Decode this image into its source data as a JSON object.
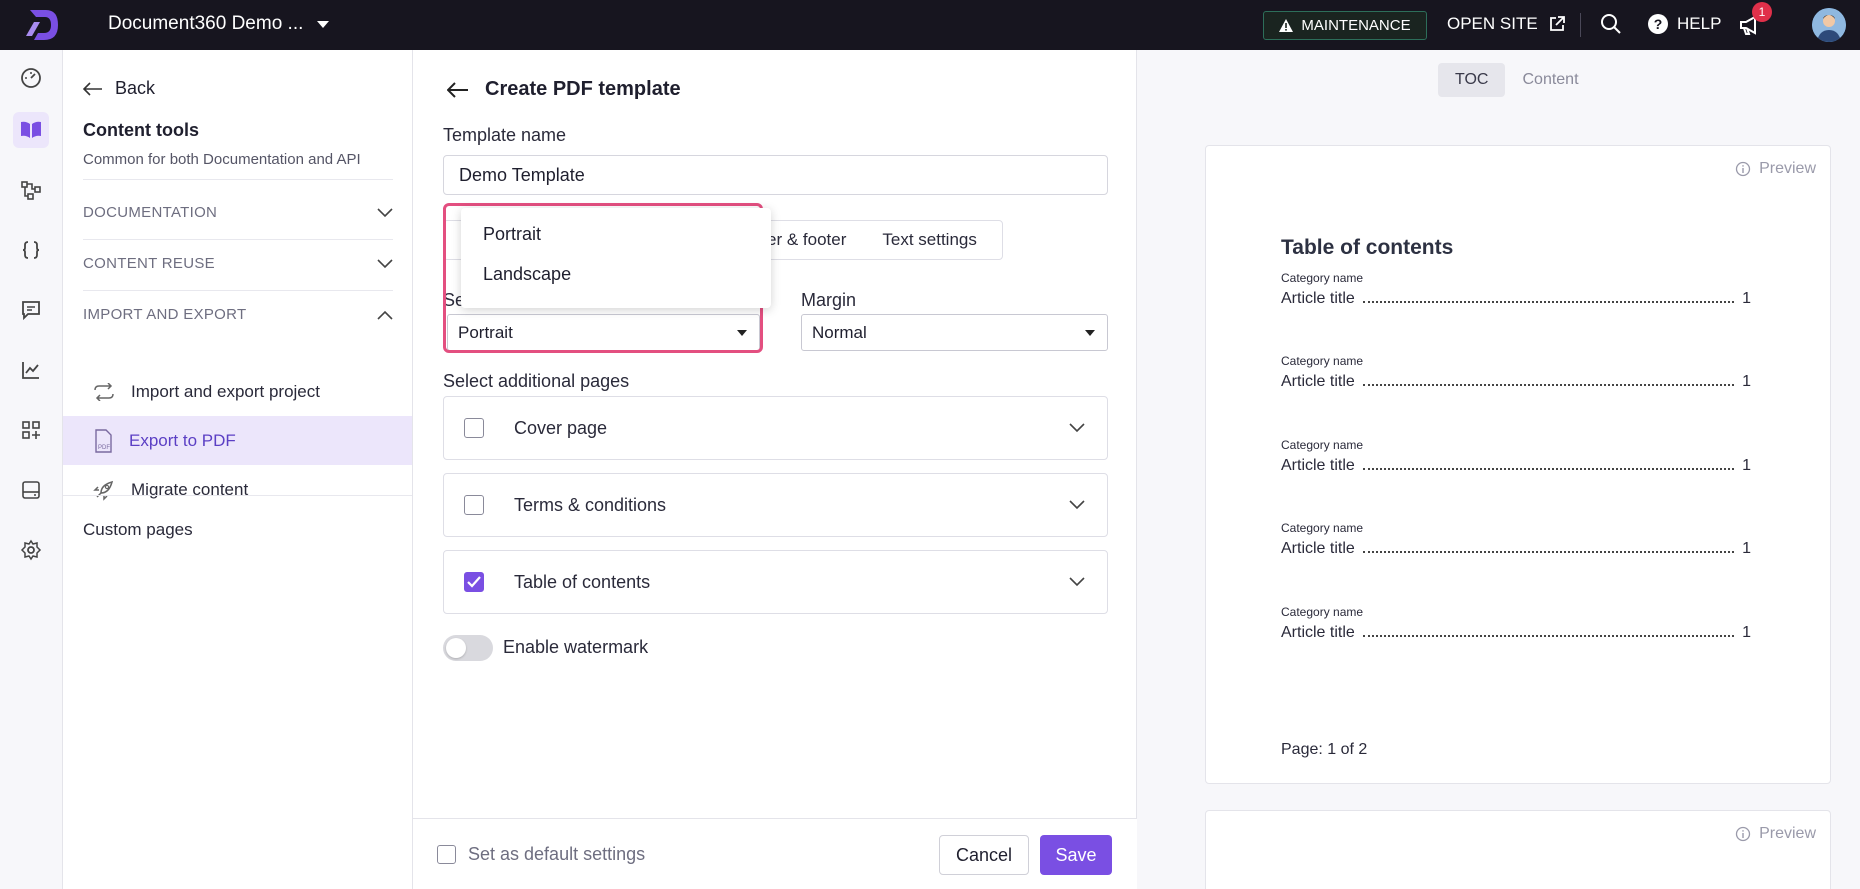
{
  "topbar": {
    "project_title": "Document360 Demo ...",
    "maintenance_label": "MAINTENANCE",
    "open_site_label": "OPEN SITE",
    "help_label": "HELP",
    "notification_count": "1"
  },
  "leftnav": {
    "back_label": "Back",
    "title": "Content tools",
    "subtitle": "Common for both Documentation and API",
    "sections": [
      {
        "label": "DOCUMENTATION",
        "expanded": false
      },
      {
        "label": "CONTENT REUSE",
        "expanded": false
      },
      {
        "label": "IMPORT AND EXPORT",
        "expanded": true
      }
    ],
    "items": [
      {
        "label": "Import and export project",
        "icon": "import-export-icon",
        "active": false
      },
      {
        "label": "Export to PDF",
        "icon": "pdf-file-icon",
        "active": true
      },
      {
        "label": "Migrate content",
        "icon": "rocket-icon",
        "active": false
      }
    ],
    "custom_pages_label": "Custom pages"
  },
  "form": {
    "page_title": "Create PDF template",
    "template_name_label": "Template name",
    "template_name_value": "Demo Template",
    "tabs": [
      "er & footer",
      "Text settings"
    ],
    "orientation_label_partial": "Se",
    "orientation_value": "Portrait",
    "orientation_options": [
      "Portrait",
      "Landscape"
    ],
    "margin_label": "Margin",
    "margin_value": "Normal",
    "additional_pages_label": "Select additional pages",
    "additional_pages": [
      {
        "label": "Cover page",
        "checked": false
      },
      {
        "label": "Terms & conditions",
        "checked": false
      },
      {
        "label": "Table of contents",
        "checked": true
      }
    ],
    "watermark_label": "Enable watermark",
    "watermark_enabled": false,
    "default_settings_label": "Set as default settings",
    "cancel_label": "Cancel",
    "save_label": "Save"
  },
  "preview": {
    "tabs": [
      "TOC",
      "Content"
    ],
    "active_tab": "TOC",
    "preview_label": "Preview",
    "toc_title": "Table of contents",
    "entries": [
      {
        "category": "Category name",
        "article": "Article title",
        "page": "1"
      },
      {
        "category": "Category name",
        "article": "Article title",
        "page": "1"
      },
      {
        "category": "Category name",
        "article": "Article title",
        "page": "1"
      },
      {
        "category": "Category name",
        "article": "Article title",
        "page": "1"
      },
      {
        "category": "Category name",
        "article": "Article title",
        "page": "1"
      }
    ],
    "page_indicator": "Page: 1 of 2"
  },
  "colors": {
    "accent": "#7a4fe3",
    "highlight": "#e34f80",
    "topbar": "#17151f"
  }
}
